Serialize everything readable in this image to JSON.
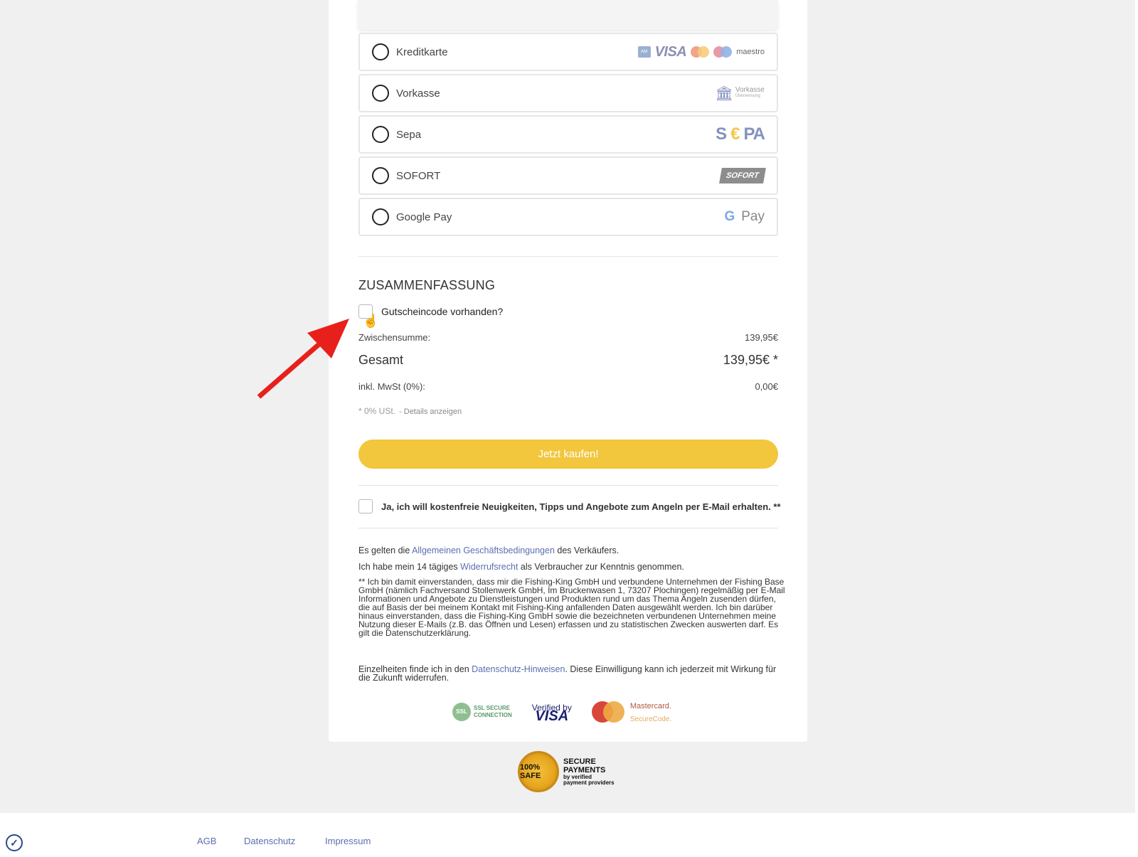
{
  "payment_methods": [
    {
      "label": "Kreditkarte"
    },
    {
      "label": "Vorkasse"
    },
    {
      "label": "Sepa"
    },
    {
      "label": "SOFORT"
    },
    {
      "label": "Google Pay"
    }
  ],
  "payment_logos": {
    "amex": "AM EX",
    "visa": "VISA",
    "maestro": "maestro",
    "vorkasse": "Vorkasse",
    "vorkasse_sub": "Überweisung",
    "sepa_s": "S",
    "sepa_euro": "€",
    "sepa_pa": "PA",
    "sofort": "SOFORT",
    "gpay_g": "G",
    "gpay_text": "Pay"
  },
  "summary": {
    "title": "ZUSAMMENFASSUNG",
    "voucher_label": "Gutscheincode vorhanden?",
    "subtotal_label": "Zwischensumme:",
    "subtotal_value": "139,95€",
    "total_label": "Gesamt",
    "total_value": "139,95€ *",
    "vat_label": "inkl. MwSt (0%):",
    "vat_value": "0,00€",
    "tax_note": "* 0% USt.",
    "tax_details_link": "- Details anzeigen",
    "buy_button": "Jetzt kaufen!",
    "newsletter_label": "Ja, ich will kostenfreie Neuigkeiten, Tipps und Angebote zum Angeln per E-Mail erhalten. **"
  },
  "legal": {
    "agb_prefix": "Es gelten die ",
    "agb_link": "Allgemeinen Geschäftsbedingungen",
    "agb_suffix": " des Verkäufers.",
    "withdrawal_prefix": "Ich habe mein 14 tägiges ",
    "withdrawal_link": "Widerrufsrecht",
    "withdrawal_suffix": " als Verbraucher zur Kenntnis genommen.",
    "consent_text": "** Ich bin damit einverstanden, dass mir die Fishing-King GmbH und verbundene Unternehmen der Fishing Base GmbH (nämlich Fachversand Stollenwerk GmbH, Im Bruckenwasen 1, 73207 Plochingen) regelmäßig per E-Mail Informationen und Angebote zu Dienstleistungen und Produkten rund um das Thema Angeln zusenden dürfen, die auf Basis der bei meinem Kontakt mit Fishing-King anfallenden Daten ausgewählt werden. Ich bin darüber hinaus einverstanden, dass die Fishing-King GmbH sowie die bezeichneten verbundenen Unternehmen meine Nutzung dieser E-Mails (z.B. das Öffnen und Lesen) erfassen und zu statistischen Zwecken auswerten darf. Es gilt die Datenschutzerklärung.",
    "details_prefix": "Einzelheiten finde ich in den ",
    "details_link": "Datenschutz-Hinweisen",
    "details_suffix": ". Diese Einwilligung kann ich jederzeit mit Wirkung für die Zukunft widerrufen."
  },
  "trust": {
    "ssl_icon": "SSL",
    "ssl_line1": "SSL SECURE",
    "ssl_line2": "CONNECTION",
    "vbv_line1": "Verified by",
    "vbv_line2": "VISA",
    "mc_line1": "Mastercard.",
    "mc_line2": "SecureCode.",
    "seal_medal": "100% SAFE",
    "seal_line1": "SECURE",
    "seal_line2": "PAYMENTS",
    "seal_line3": "by verified",
    "seal_line4": "payment providers"
  },
  "footer": {
    "agb": "AGB",
    "datenschutz": "Datenschutz",
    "impressum": "Impressum"
  },
  "colors": {
    "buy_button": "#f2c63d",
    "link": "#5b6fb0",
    "arrow": "#e8201c"
  }
}
